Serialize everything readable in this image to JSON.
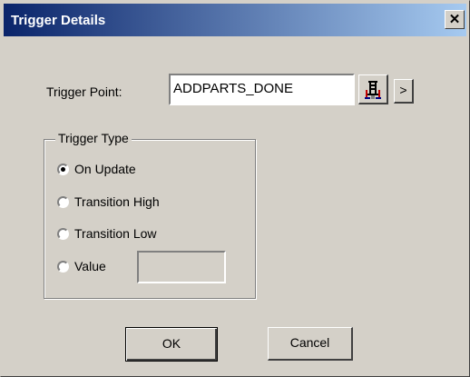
{
  "window": {
    "title": "Trigger Details",
    "close_label": "✕"
  },
  "trigger_point": {
    "label": "Trigger Point:",
    "value": "ADDPARTS_DONE",
    "browse_icon": "tag-browse-icon",
    "arrow_label": ">"
  },
  "trigger_type": {
    "legend": "Trigger Type",
    "options": [
      {
        "label": "On Update",
        "selected": true
      },
      {
        "label": "Transition High",
        "selected": false
      },
      {
        "label": "Transition Low",
        "selected": false
      },
      {
        "label": "Value",
        "selected": false
      }
    ],
    "value_field": ""
  },
  "buttons": {
    "ok": "OK",
    "cancel": "Cancel"
  },
  "colors": {
    "title_start": "#0a246a",
    "title_end": "#a6caf0",
    "face": "#d4d0c8"
  }
}
